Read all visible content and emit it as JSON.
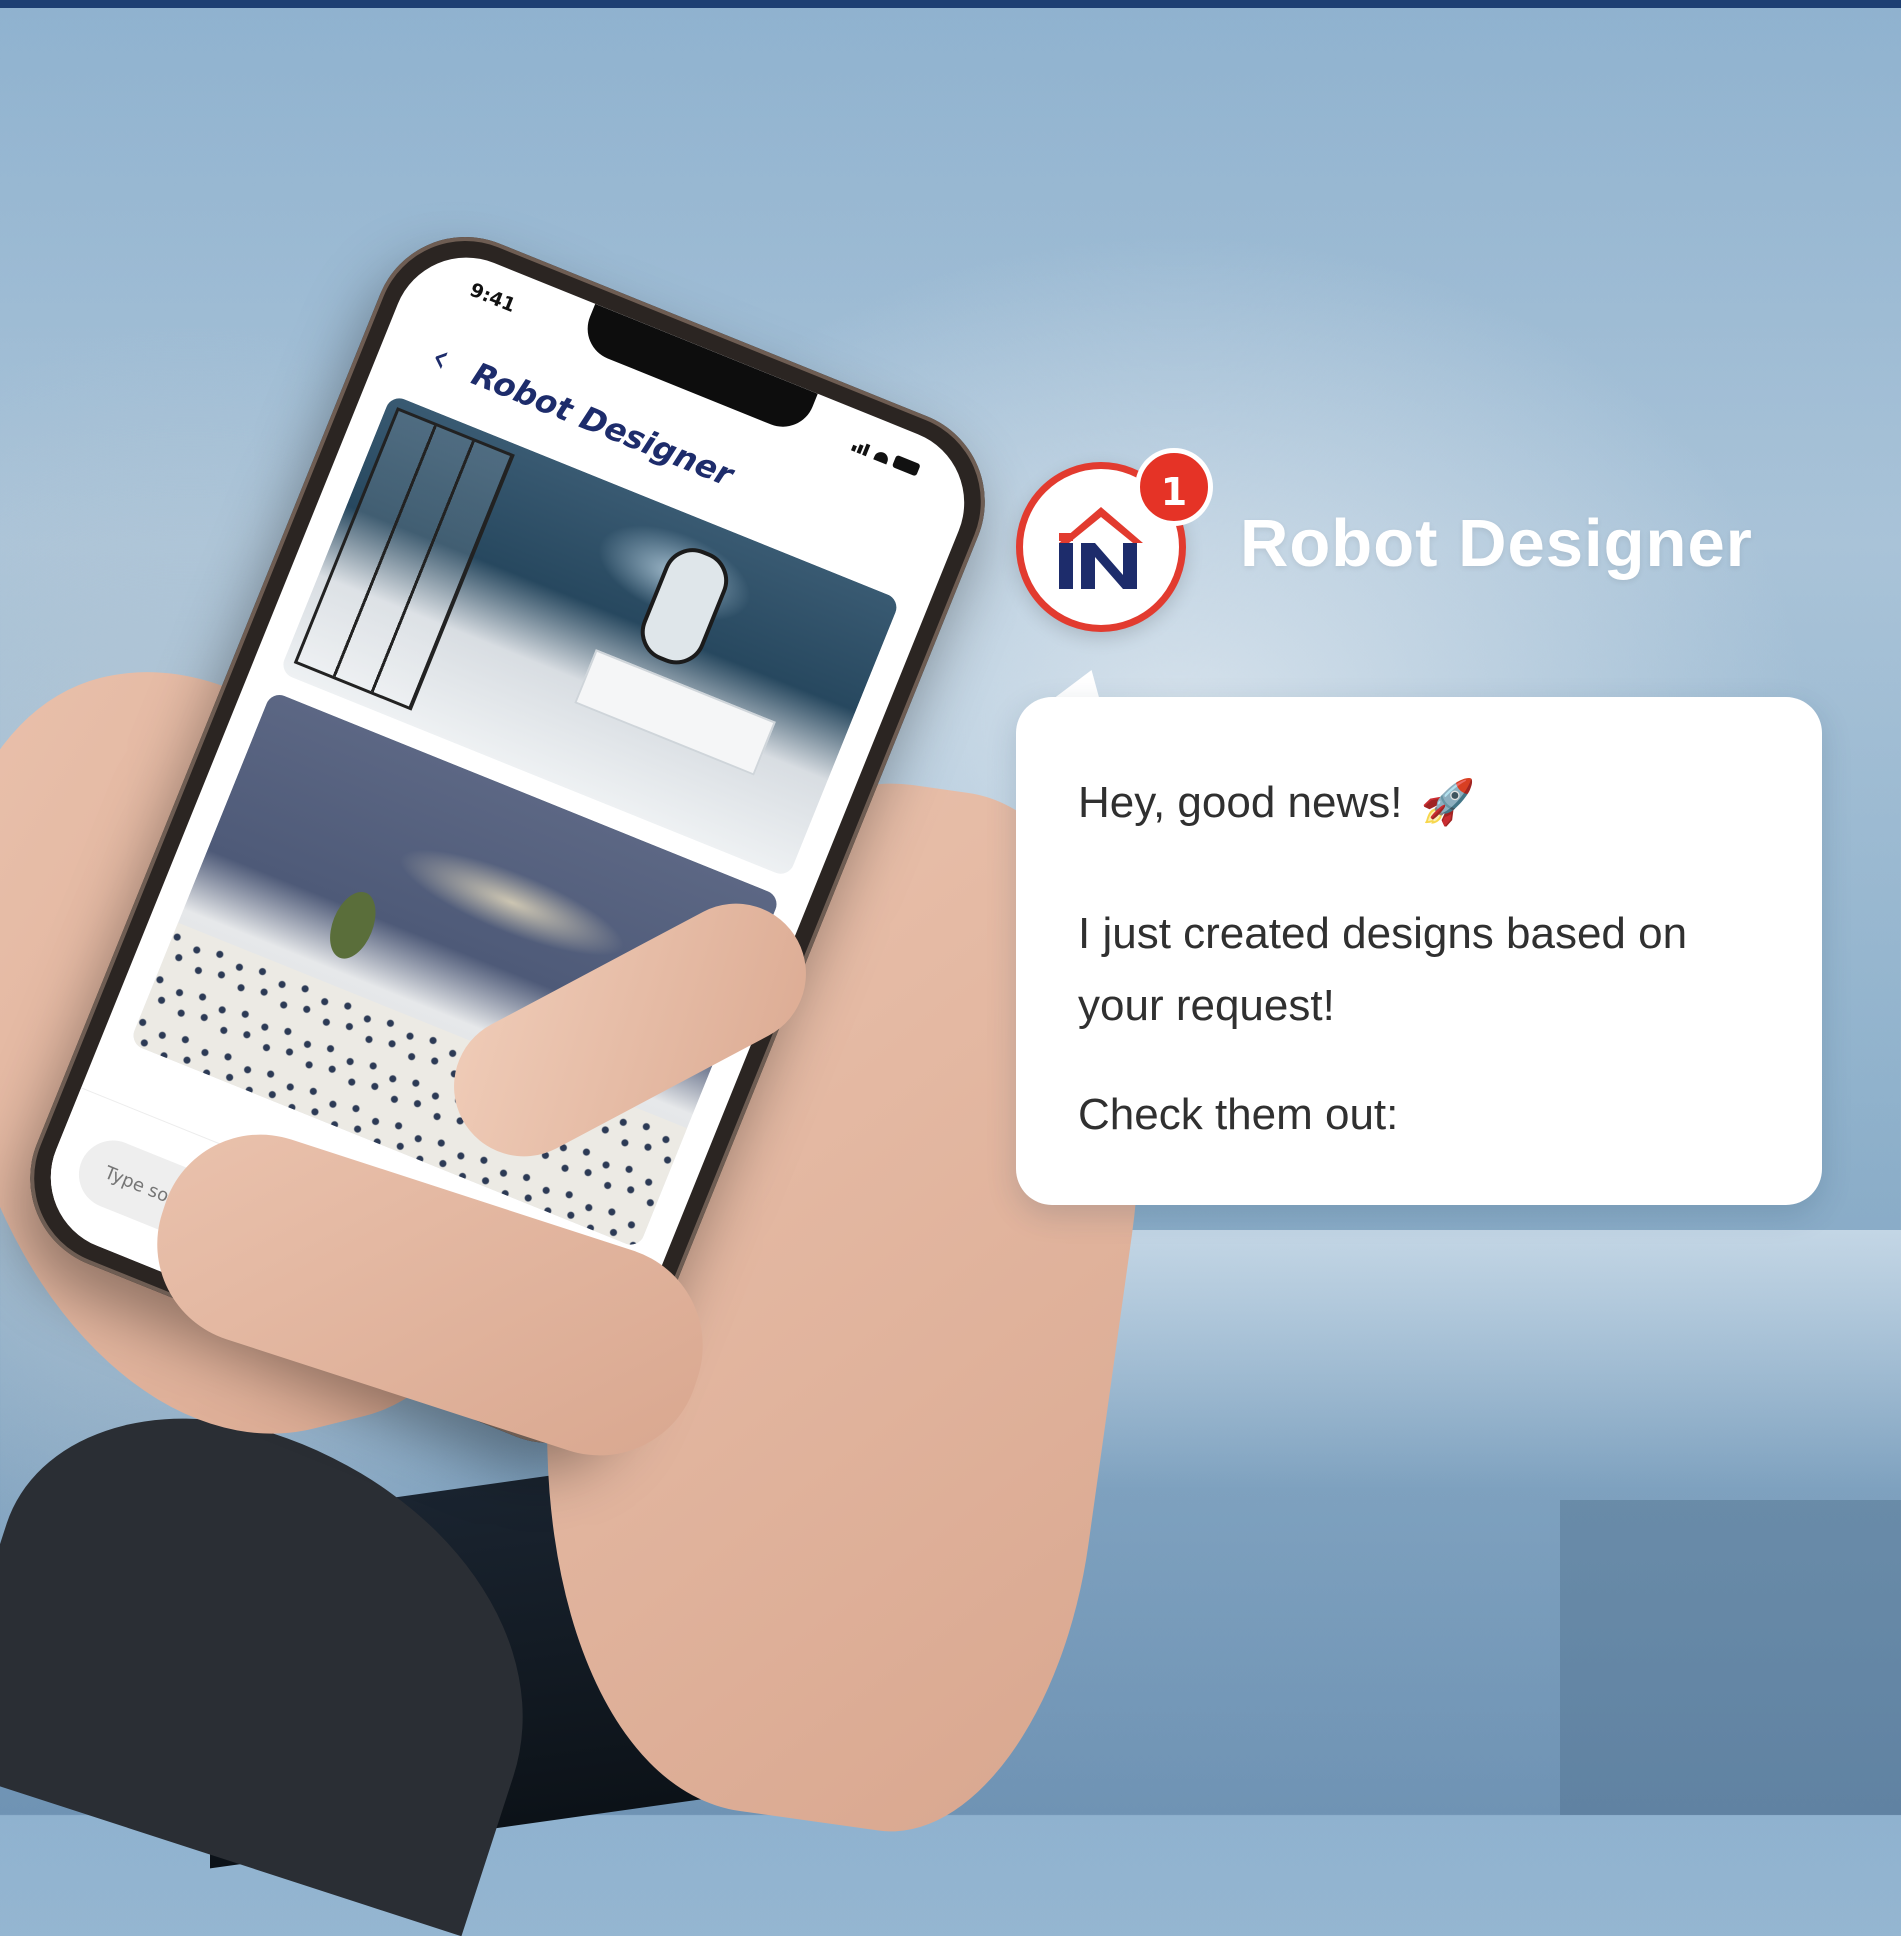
{
  "phone": {
    "status_time": "9:41",
    "header_title": "Robot Designer",
    "input_placeholder": "Type something"
  },
  "notification": {
    "badge_count": "1",
    "sender": "Robot Designer",
    "logo_text": "iN",
    "messages": {
      "line1": "Hey, good news!",
      "line2": "I just created designs based on your request!",
      "line3": "Check them out:"
    }
  },
  "colors": {
    "brand_navy": "#1d2c6b",
    "brand_red": "#e23b2f",
    "top_bar": "#1d3f73"
  },
  "icons": [
    "back-chevron-icon",
    "camera-icon",
    "rocket-icon",
    "signal-icon",
    "wifi-icon",
    "battery-icon"
  ]
}
